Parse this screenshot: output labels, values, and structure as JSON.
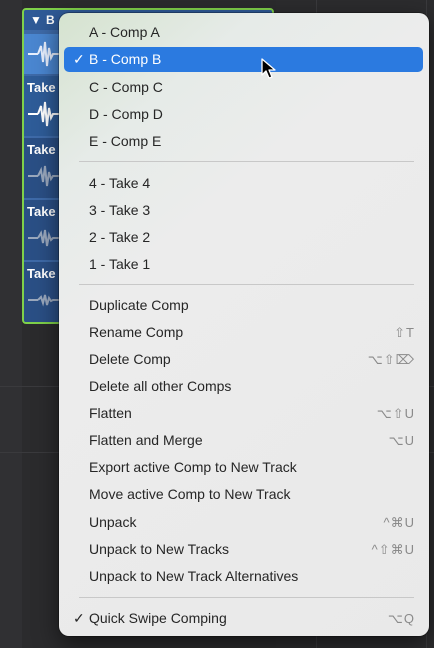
{
  "take_folder": {
    "header_label": "B",
    "lanes": [
      {
        "label": ""
      },
      {
        "label": "Take"
      },
      {
        "label": "Take"
      },
      {
        "label": "Take"
      },
      {
        "label": "Take"
      }
    ]
  },
  "menu": {
    "comps": [
      {
        "label": "A - Comp A",
        "checked": false,
        "selected": false
      },
      {
        "label": "B - Comp B",
        "checked": true,
        "selected": true
      },
      {
        "label": "C - Comp C",
        "checked": false,
        "selected": false
      },
      {
        "label": "D - Comp D",
        "checked": false,
        "selected": false
      },
      {
        "label": "E - Comp E",
        "checked": false,
        "selected": false
      }
    ],
    "takes": [
      {
        "label": "4 - Take 4"
      },
      {
        "label": "3 - Take 3"
      },
      {
        "label": "2 - Take 2"
      },
      {
        "label": "1 - Take 1"
      }
    ],
    "actions": [
      {
        "label": "Duplicate Comp",
        "shortcut": ""
      },
      {
        "label": "Rename Comp",
        "shortcut": "⇧T"
      },
      {
        "label": "Delete Comp",
        "shortcut": "⌥⇧⌦"
      },
      {
        "label": "Delete all other Comps",
        "shortcut": ""
      },
      {
        "label": "Flatten",
        "shortcut": "⌥⇧U"
      },
      {
        "label": "Flatten and Merge",
        "shortcut": "⌥U"
      },
      {
        "label": "Export active Comp to New Track",
        "shortcut": ""
      },
      {
        "label": "Move active Comp to New Track",
        "shortcut": ""
      },
      {
        "label": "Unpack",
        "shortcut": "^⌘U"
      },
      {
        "label": "Unpack to New Tracks",
        "shortcut": "^⇧⌘U"
      },
      {
        "label": "Unpack to New Track Alternatives",
        "shortcut": ""
      }
    ],
    "quick_swipe": {
      "label": "Quick Swipe Comping",
      "shortcut": "⌥Q",
      "checked": true
    },
    "checkmark": "✓"
  },
  "colors": {
    "selection": "#2b7ae0",
    "folder_outline": "#7fd14a"
  }
}
